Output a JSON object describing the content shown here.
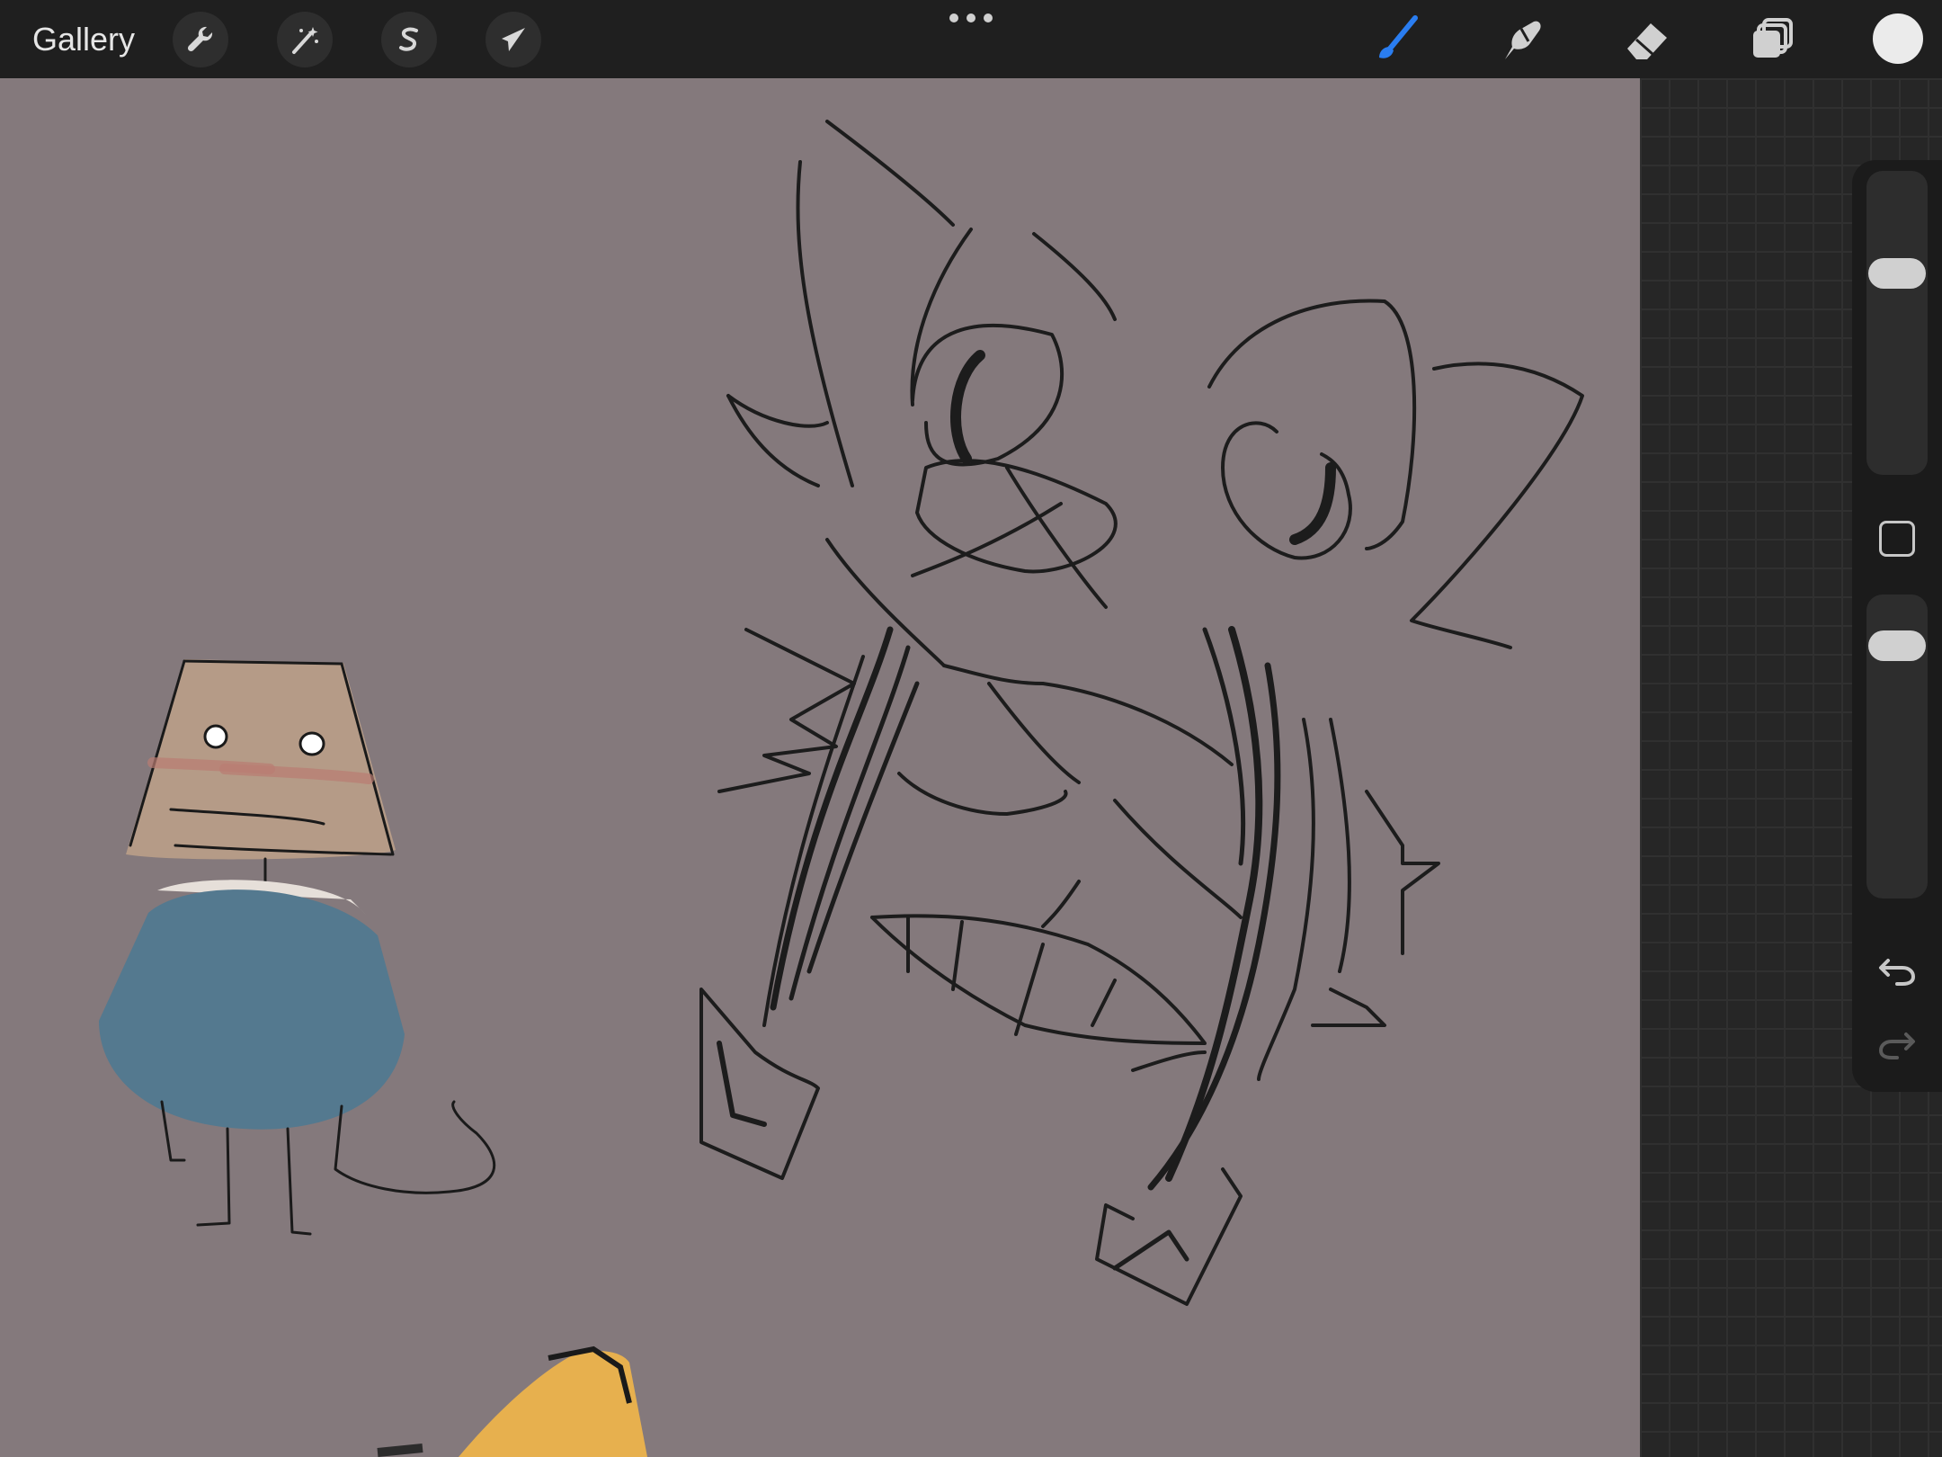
{
  "toolbar": {
    "gallery_label": "Gallery",
    "left_tools": [
      {
        "name": "actions",
        "icon": "wrench-icon"
      },
      {
        "name": "adjustments",
        "icon": "magic-wand-icon"
      },
      {
        "name": "selection",
        "icon": "selection-s-icon"
      },
      {
        "name": "transform",
        "icon": "arrow-cursor-icon"
      }
    ],
    "right_tools": [
      {
        "name": "brush",
        "icon": "brush-icon",
        "active": true
      },
      {
        "name": "smudge",
        "icon": "smudge-finger-icon",
        "active": false
      },
      {
        "name": "eraser",
        "icon": "eraser-icon",
        "active": false
      },
      {
        "name": "layers",
        "icon": "layers-icon",
        "active": false
      }
    ],
    "current_color": "#ebebeb",
    "active_color": "#2a7df0"
  },
  "sidebar": {
    "brush_size_level": 0.68,
    "opacity_level": 0.87,
    "undo_icon": "undo-icon",
    "redo_icon": "redo-icon",
    "modify_icon": "square-modify-icon"
  },
  "canvas": {
    "background": "#84797c"
  }
}
